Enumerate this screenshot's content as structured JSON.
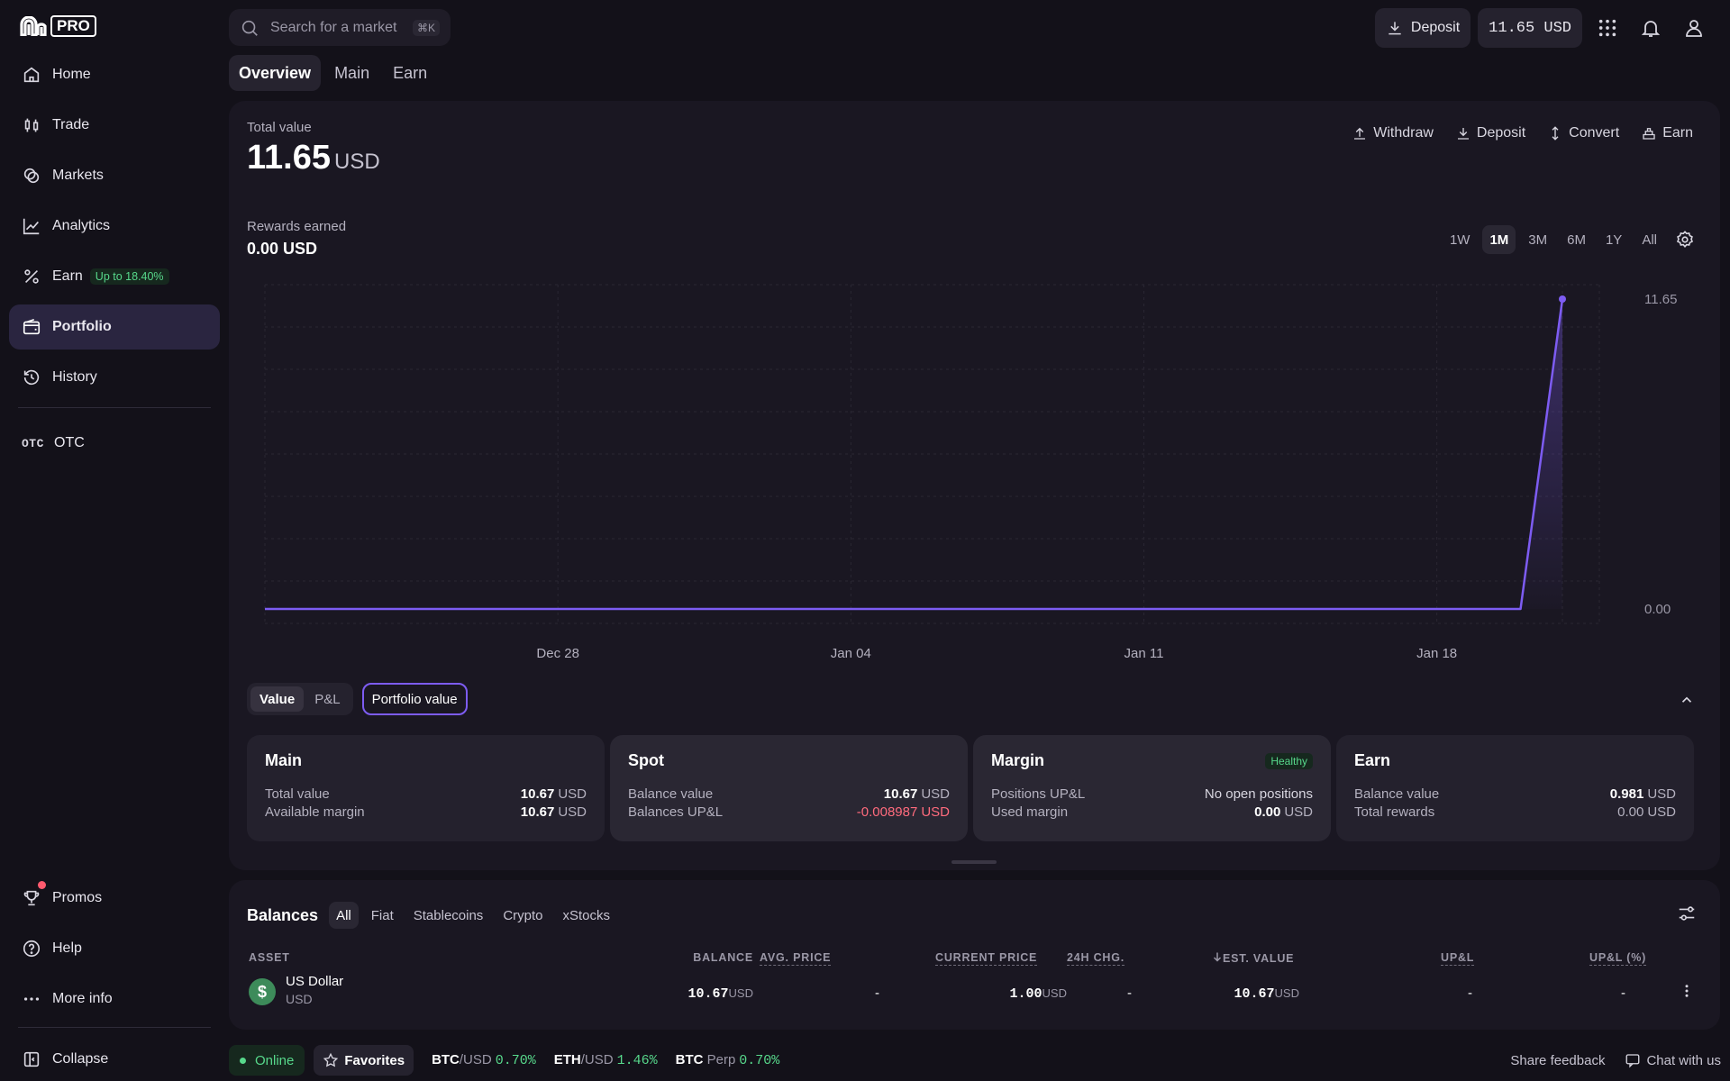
{
  "brand": {
    "logo_text": "PRO"
  },
  "sidebar": {
    "items": [
      {
        "label": "Home",
        "icon": "home-icon"
      },
      {
        "label": "Trade",
        "icon": "candles-icon"
      },
      {
        "label": "Markets",
        "icon": "coins-icon"
      },
      {
        "label": "Analytics",
        "icon": "analytics-icon"
      },
      {
        "label": "Earn",
        "icon": "percent-icon",
        "badge": "Up to 18.40%"
      },
      {
        "label": "Portfolio",
        "icon": "wallet-icon",
        "active": true
      },
      {
        "label": "History",
        "icon": "history-icon"
      }
    ],
    "otc": {
      "glyph": "OTC",
      "label": "OTC"
    },
    "bottom": [
      {
        "label": "Promos",
        "icon": "trophy-icon"
      },
      {
        "label": "Help",
        "icon": "help-icon"
      },
      {
        "label": "More info",
        "icon": "more-icon"
      }
    ],
    "collapse": "Collapse"
  },
  "topbar": {
    "search_placeholder": "Search for a market",
    "search_shortcut": "⌘K",
    "deposit": "Deposit",
    "balance": "11.65 USD"
  },
  "tabs": [
    {
      "label": "Overview",
      "active": true
    },
    {
      "label": "Main"
    },
    {
      "label": "Earn"
    }
  ],
  "overview": {
    "total_label": "Total value",
    "total_value": "11.65",
    "total_unit": "USD",
    "actions": [
      "Withdraw",
      "Deposit",
      "Convert",
      "Earn"
    ],
    "rewards_label": "Rewards earned",
    "rewards_value": "0.00 USD",
    "ranges": [
      "1W",
      "1M",
      "3M",
      "6M",
      "1Y",
      "All"
    ],
    "active_range": "1M",
    "toggles": [
      "Value",
      "P&L"
    ],
    "portfolio_value": "Portfolio value"
  },
  "chart_data": {
    "type": "line",
    "x": [
      "Dec 21",
      "Dec 28",
      "Jan 04",
      "Jan 11",
      "Jan 18",
      "Jan 20",
      "Jan 21"
    ],
    "values": [
      0.0,
      0.0,
      0.0,
      0.0,
      0.0,
      0.0,
      11.65
    ],
    "x_ticks": [
      "Dec 28",
      "Jan 04",
      "Jan 11",
      "Jan 18"
    ],
    "y_labels": [
      "11.65",
      "0.00"
    ],
    "ylim": [
      0,
      11.65
    ],
    "grid": true,
    "color": "#7d5cf2"
  },
  "summary": [
    {
      "title": "Main",
      "rows": [
        {
          "label": "Total value",
          "value": "10.67",
          "unit": "USD"
        },
        {
          "label": "Available margin",
          "value": "10.67",
          "unit": "USD"
        }
      ]
    },
    {
      "title": "Spot",
      "rows": [
        {
          "label": "Balance value",
          "value": "10.67",
          "unit": "USD"
        },
        {
          "label": "Balances UP&L",
          "value": "-0.008987",
          "unit": "USD",
          "negative": true
        }
      ]
    },
    {
      "title": "Margin",
      "badge": "Healthy",
      "rows": [
        {
          "label": "Positions UP&L",
          "value": "No open positions",
          "unit": ""
        },
        {
          "label": "Used margin",
          "value": "0.00",
          "unit": "USD"
        }
      ]
    },
    {
      "title": "Earn",
      "rows": [
        {
          "label": "Balance value",
          "value": "0.981",
          "unit": "USD"
        },
        {
          "label": "Total rewards",
          "value": "0.00",
          "unit": "USD"
        }
      ]
    }
  ],
  "balances": {
    "title": "Balances",
    "filters": [
      "All",
      "Fiat",
      "Stablecoins",
      "Crypto",
      "xStocks"
    ],
    "columns": [
      "ASSET",
      "BALANCE",
      "AVG. PRICE",
      "CURRENT PRICE",
      "24H CHG.",
      "EST. VALUE",
      "UP&L",
      "UP&L (%)"
    ],
    "rows": [
      {
        "icon": "$",
        "name": "US Dollar",
        "code": "USD",
        "balance": "10.67",
        "balance_unit": "USD",
        "avg_price": "-",
        "current_price": "1.00",
        "current_unit": "USD",
        "chg": "-",
        "est_value": "10.67",
        "est_unit": "USD",
        "upl": "-",
        "upl_pct": "-"
      }
    ]
  },
  "status": {
    "online": "Online",
    "favorites": "Favorites",
    "tickers": [
      {
        "base": "BTC",
        "quote": "/USD",
        "pct": "0.70%"
      },
      {
        "base": "ETH",
        "quote": "/USD",
        "pct": "1.46%"
      },
      {
        "base": "BTC",
        "quote": " Perp",
        "pct": "0.70%"
      }
    ],
    "share_feedback": "Share feedback",
    "chat": "Chat with us"
  },
  "colors": {
    "accent": "#7d5cf2",
    "positive": "#57d88b",
    "negative": "#ff6b7d",
    "background": "#131119",
    "card": "#1a1722"
  }
}
